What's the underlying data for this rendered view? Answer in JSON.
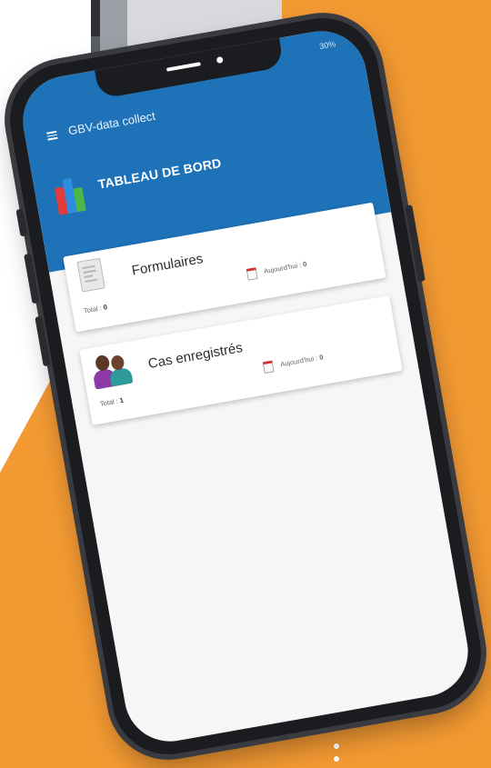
{
  "app": {
    "title": "GBV-data collect",
    "status_text": "30%"
  },
  "dashboard": {
    "title": "TABLEAU DE BORD"
  },
  "cards": [
    {
      "title": "Formulaires",
      "total_label": "Total :",
      "total_value": "0",
      "today_label": "Aujourd'hui :",
      "today_value": "0"
    },
    {
      "title": "Cas enregistrés",
      "total_label": "Total :",
      "total_value": "1",
      "today_label": "Aujourd'hui :",
      "today_value": "0"
    }
  ],
  "icons": {
    "menu": "menu-icon",
    "dashboard": "bar-chart-icon",
    "forms": "form-document-icon",
    "cases": "people-icon",
    "calendar": "calendar-icon"
  },
  "colors": {
    "app_bar": "#1e72b8",
    "background_accent": "#f39a33",
    "phone_frame": "#1b1c1f"
  }
}
